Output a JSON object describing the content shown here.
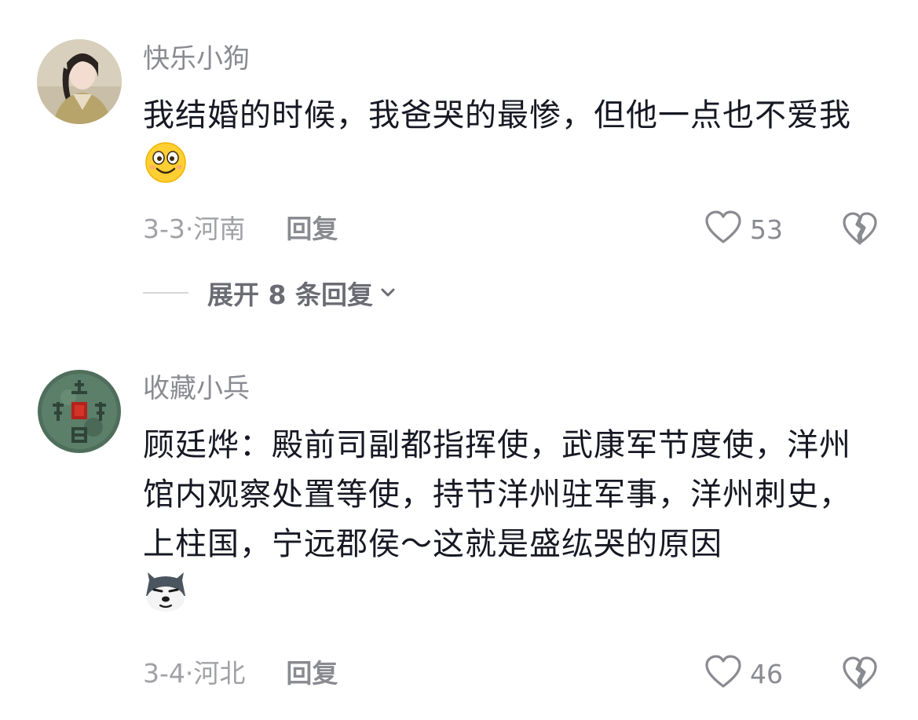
{
  "comments": [
    {
      "username": "快乐小狗",
      "text": "我结婚的时候，我爸哭的最惨，但他一点也不爱我",
      "emoji": "smile-emoji",
      "date": "3-3",
      "location": "河南",
      "reply_label": "回复",
      "likes": "53",
      "expand_label": "展开 8 条回复"
    },
    {
      "username": "收藏小兵",
      "text": "顾廷烨：殿前司副都指挥使，武康军节度使，洋州馆内观察处置等使，持节洋州驻军事，洋州刺史，上柱国，宁远郡侯～这就是盛纮哭的原因",
      "emoji": "husky-emoji",
      "date": "3-4",
      "location": "河北",
      "reply_label": "回复",
      "likes": "46"
    }
  ],
  "colors": {
    "text_primary": "#161823",
    "text_secondary": "#8a8b91",
    "icon_gray": "#8a8b91"
  }
}
